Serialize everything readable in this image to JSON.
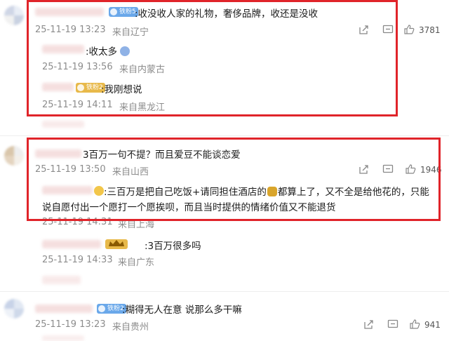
{
  "comments": [
    {
      "badge": "铁粉5",
      "text": ":收没收人家的礼物，奢侈品牌，收还是没收",
      "date": "25-11-19 13:23",
      "location": "来自辽宁",
      "likes": "3781",
      "replies": [
        {
          "text": ":收太多",
          "date": "25-11-19 13:56",
          "location": "来自内蒙古"
        },
        {
          "badge": "铁粉2",
          "text": ":我刚想说",
          "date": "25-11-19 14:11",
          "location": "来自黑龙江"
        }
      ]
    },
    {
      "text": "3百万一句不提？而且爱豆不能谈恋爱",
      "date": "25-11-19 13:50",
      "location": "来自山西",
      "likes": "1946",
      "replies": [
        {
          "text_line1": ":三百万是把自己吃饭+请同担住酒店的",
          "text_line1b": "都算上了，又不全是给他花的，只能",
          "text_line2": "说自愿付出一个愿打一个愿挨呗，而且当时提供的情绪价值又不能退货",
          "date": "25-11-19 14:31",
          "location": "来自上海"
        },
        {
          "text": ":3百万很多吗",
          "date": "25-11-19 14:33",
          "location": "来自广东"
        }
      ]
    },
    {
      "badge": "铁粉2",
      "text": ":糊得无人在意 说那么多干嘛",
      "date": "25-11-19 13:23",
      "location": "来自贵州",
      "likes": "941"
    }
  ],
  "colors": {
    "highlight_box": "#e0242a",
    "meta_text": "#8c8c8c"
  },
  "icons": [
    "share-icon",
    "comment-icon",
    "like-icon"
  ]
}
